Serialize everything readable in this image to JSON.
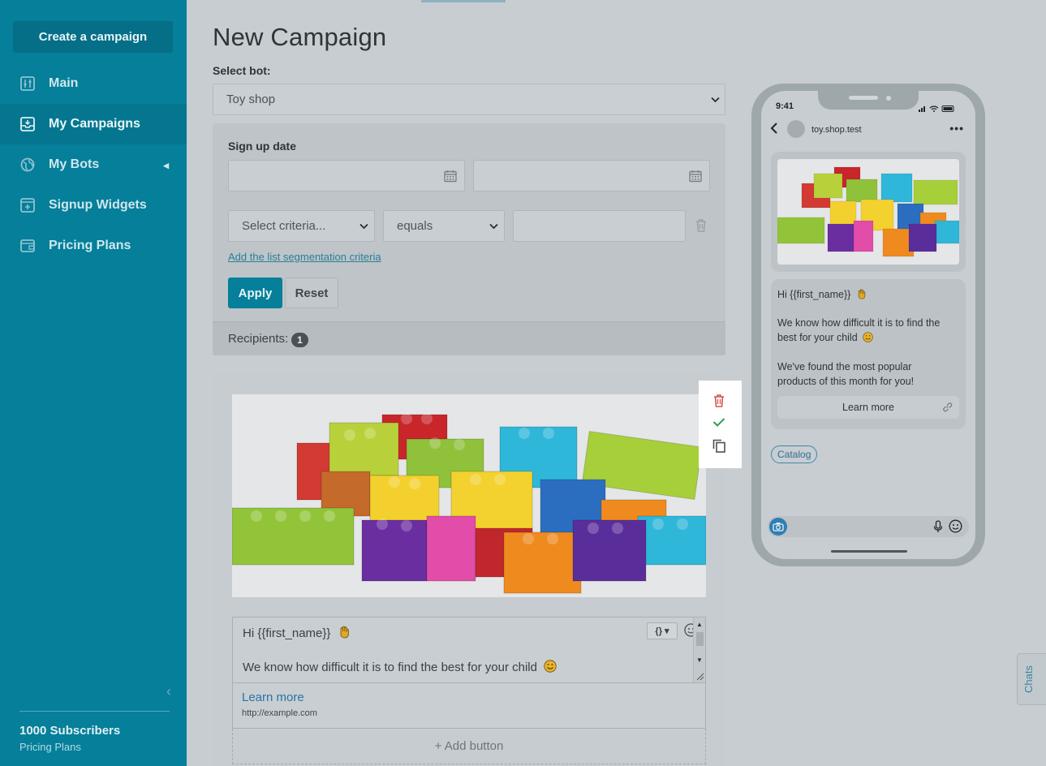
{
  "sidebar": {
    "create_button": "Create a campaign",
    "items": [
      {
        "label": "Main",
        "icon": "sliders-icon"
      },
      {
        "label": "My Campaigns",
        "icon": "inbox-icon",
        "active": true
      },
      {
        "label": "My Bots",
        "icon": "globe-icon"
      },
      {
        "label": "Signup Widgets",
        "icon": "widget-add-icon"
      },
      {
        "label": "Pricing Plans",
        "icon": "wallet-icon"
      }
    ],
    "subscribers": "1000 Subscribers",
    "pricing_link": "Pricing Plans",
    "collapse_glyph": "‹"
  },
  "page": {
    "title": "New Campaign",
    "select_bot_label": "Select bot:",
    "bot_value": "Toy shop"
  },
  "filters": {
    "signup_label": "Sign up date",
    "criteria_placeholder": "Select criteria...",
    "operator": "equals",
    "add_criteria_link": "Add the list segmentation criteria",
    "apply": "Apply",
    "reset": "Reset",
    "recipients_label": "Recipients:",
    "recipients_count": "1"
  },
  "message": {
    "line1": "Hi {{first_name}}",
    "line2": "We know how difficult it is to find the best for your child",
    "variables_button": "{}",
    "button_title": "Learn more",
    "button_url": "http://example.com",
    "add_button": "+ Add button"
  },
  "preview": {
    "time": "9:41",
    "page_name": "toy.shop.test",
    "more": "•••",
    "text1": "Hi {{first_name}}",
    "text2a": "We know how difficult it is to find the",
    "text2b": "best for your child",
    "text3a": "We've found the most popular",
    "text3b": "products of this month for you!",
    "button": "Learn more",
    "quick_reply": "Catalog"
  },
  "chats_tab": "Chats",
  "colors": {
    "brand": "#057f9a",
    "delete": "#d9534f",
    "confirm": "#2e9c5a"
  }
}
